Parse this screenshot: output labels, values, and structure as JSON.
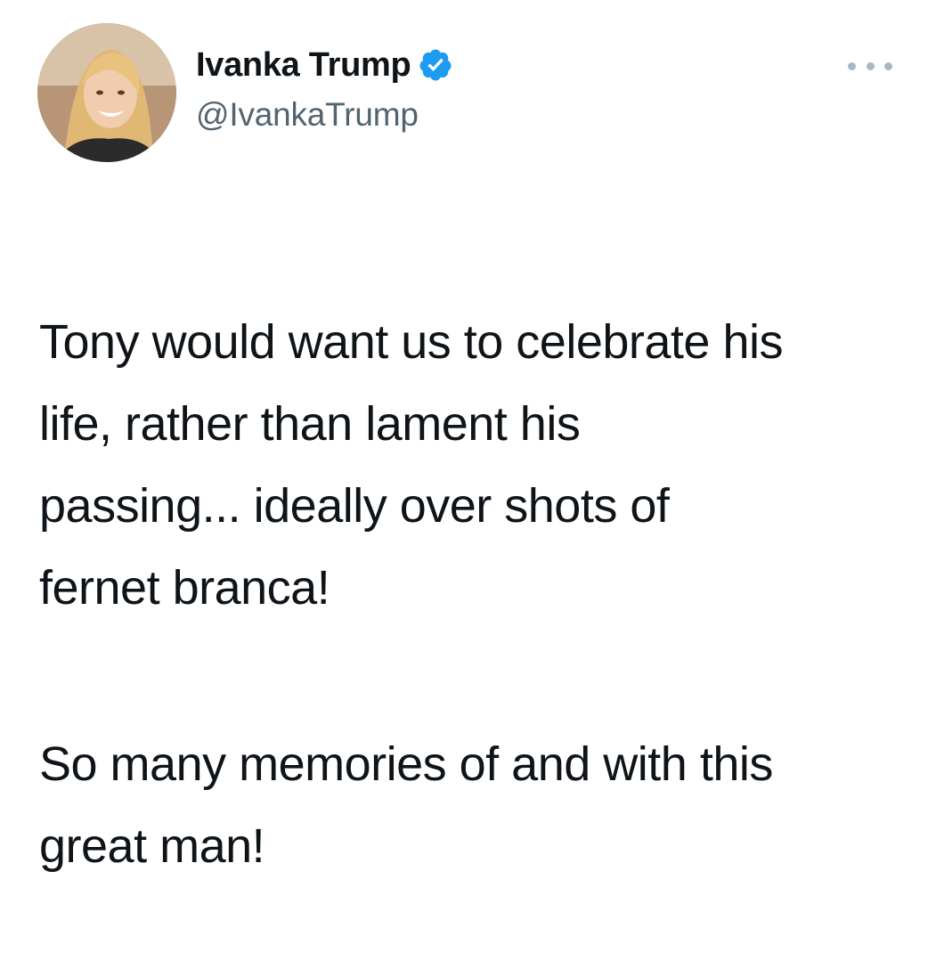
{
  "tweet": {
    "author": {
      "display_name": "Ivanka Trump",
      "handle": "@IvankaTrump",
      "verified": true,
      "avatar_icon": "profile-photo",
      "verified_icon": "verified-badge-icon",
      "verified_color": "#1d9bf0"
    },
    "more_icon": "more-options-icon",
    "text": {
      "paragraph_1": "Tony would want us to celebrate his\nlife, rather than lament his\npassing... ideally over shots of\nfernet branca!",
      "paragraph_2": "So many memories of and with this\ngreat man!"
    }
  }
}
